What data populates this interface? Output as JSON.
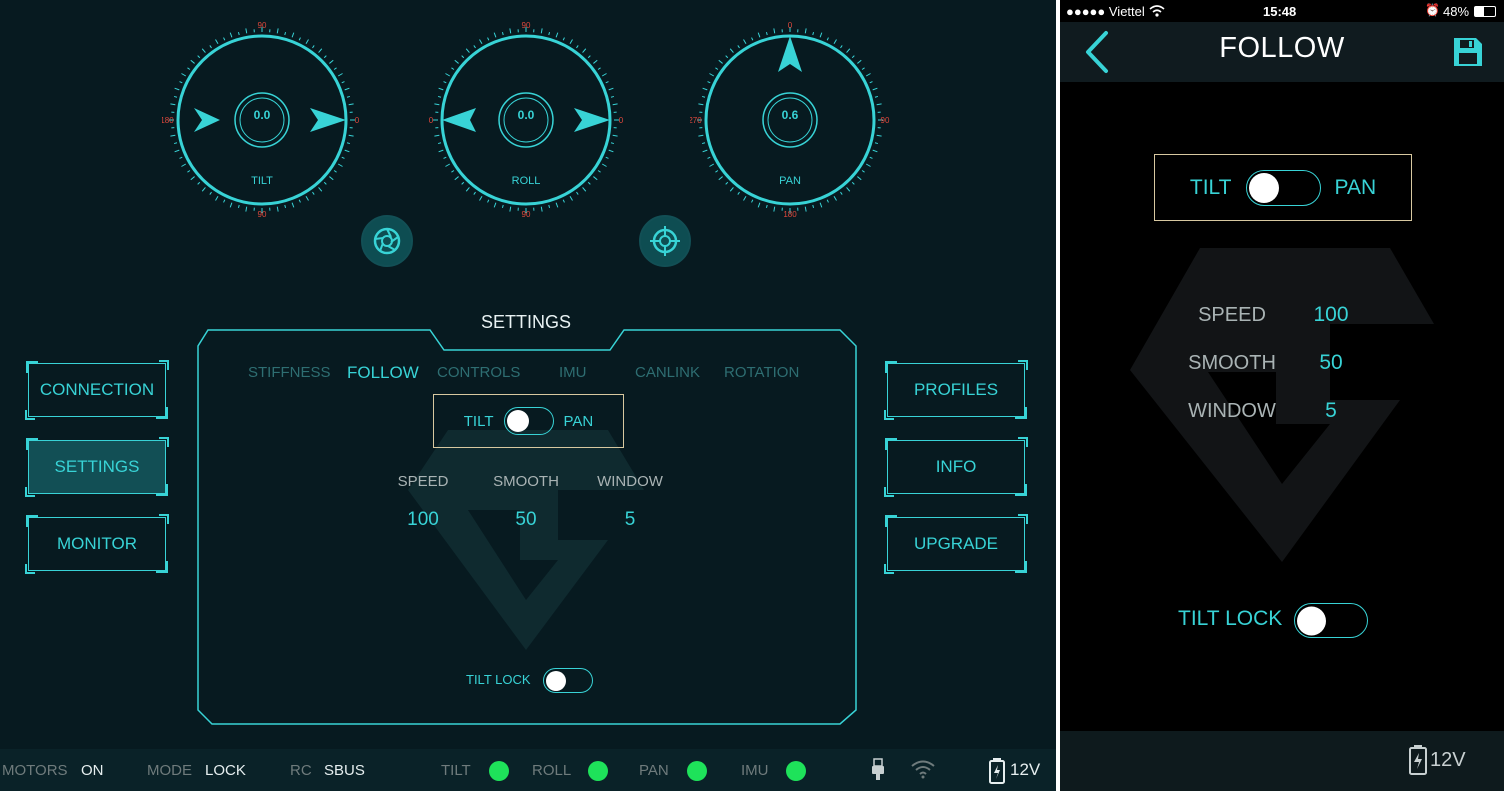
{
  "tablet": {
    "dials": [
      {
        "name": "TILT",
        "value": "0.0"
      },
      {
        "name": "ROLL",
        "value": "0.0"
      },
      {
        "name": "PAN",
        "value": "0.6"
      }
    ],
    "dial_ticks": {
      "tilt": {
        "top": "90",
        "right": "0",
        "left": "180",
        "bottom": "90"
      },
      "roll": {
        "top": "90",
        "right": "0",
        "left": "0",
        "bottom": "90"
      },
      "pan": {
        "top": "0",
        "right": "90",
        "left": "270",
        "bottom": "180"
      }
    },
    "left_nav": [
      {
        "label": "CONNECTION"
      },
      {
        "label": "SETTINGS"
      },
      {
        "label": "MONITOR"
      }
    ],
    "right_nav": [
      {
        "label": "PROFILES"
      },
      {
        "label": "INFO"
      },
      {
        "label": "UPGRADE"
      }
    ],
    "settings": {
      "title": "SETTINGS",
      "tabs": [
        {
          "label": "STIFFNESS"
        },
        {
          "label": "FOLLOW"
        },
        {
          "label": "CONTROLS"
        },
        {
          "label": "IMU"
        },
        {
          "label": "CANLINK"
        },
        {
          "label": "ROTATION"
        }
      ],
      "axis_toggle": {
        "left": "TILT",
        "right": "PAN"
      },
      "params": [
        {
          "label": "SPEED",
          "value": "100"
        },
        {
          "label": "SMOOTH",
          "value": "50"
        },
        {
          "label": "WINDOW",
          "value": "5"
        }
      ],
      "tilt_lock_label": "TILT LOCK"
    },
    "status": {
      "motors_label": "MOTORS",
      "motors_value": "ON",
      "mode_label": "MODE",
      "mode_value": "LOCK",
      "rc_label": "RC",
      "rc_value": "SBUS",
      "indicators": [
        {
          "label": "TILT"
        },
        {
          "label": "ROLL"
        },
        {
          "label": "PAN"
        },
        {
          "label": "IMU"
        }
      ],
      "voltage": "12V"
    },
    "colors": {
      "accent": "#38d3d6",
      "led": "#1ee25a",
      "background": "#071a20"
    }
  },
  "phone": {
    "status_bar": {
      "carrier": "●●●●● Viettel",
      "time": "15:48",
      "battery": "48%"
    },
    "title": "FOLLOW",
    "axis_toggle": {
      "left": "TILT",
      "right": "PAN"
    },
    "params": [
      {
        "label": "SPEED",
        "value": "100"
      },
      {
        "label": "SMOOTH",
        "value": "50"
      },
      {
        "label": "WINDOW",
        "value": "5"
      }
    ],
    "tilt_lock_label": "TILT LOCK",
    "voltage": "12V"
  }
}
